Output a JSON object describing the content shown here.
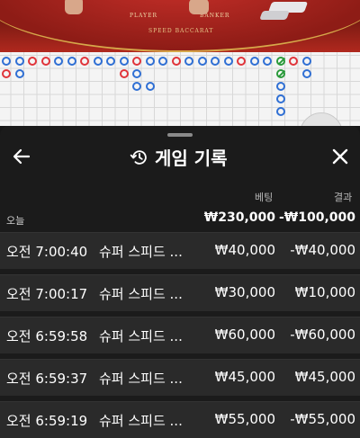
{
  "video": {
    "player_label": "PLAYER",
    "banker_label": "BANKER",
    "table_title": "SPEED BACCARAT"
  },
  "roadmap": {
    "colors": {
      "banker": "#2f6fd4",
      "player": "#e0343a",
      "tie": "#2b9a3b"
    }
  },
  "scroll_button": {
    "icon": "double-chevron-up-icon"
  },
  "sheet": {
    "title": "게임 기록",
    "title_icon": "history-icon",
    "back_icon": "arrow-left-icon",
    "close_icon": "close-icon",
    "columns": {
      "bet": "베팅",
      "result": "결과"
    },
    "summary": {
      "label": "오늘",
      "bet": "₩230,000",
      "result": "-₩100,000"
    },
    "rows": [
      {
        "time": "오전 7:00:40",
        "game": "슈퍼 스피드 ...",
        "bet": "₩40,000",
        "result": "-₩40,000"
      },
      {
        "time": "오전 7:00:17",
        "game": "슈퍼 스피드 ...",
        "bet": "₩30,000",
        "result": "₩10,000"
      },
      {
        "time": "오전 6:59:58",
        "game": "슈퍼 스피드 ...",
        "bet": "₩60,000",
        "result": "-₩60,000"
      },
      {
        "time": "오전 6:59:37",
        "game": "슈퍼 스피드 ...",
        "bet": "₩45,000",
        "result": "₩45,000"
      },
      {
        "time": "오전 6:59:19",
        "game": "슈퍼 스피드 ...",
        "bet": "₩55,000",
        "result": "-₩55,000"
      }
    ]
  }
}
